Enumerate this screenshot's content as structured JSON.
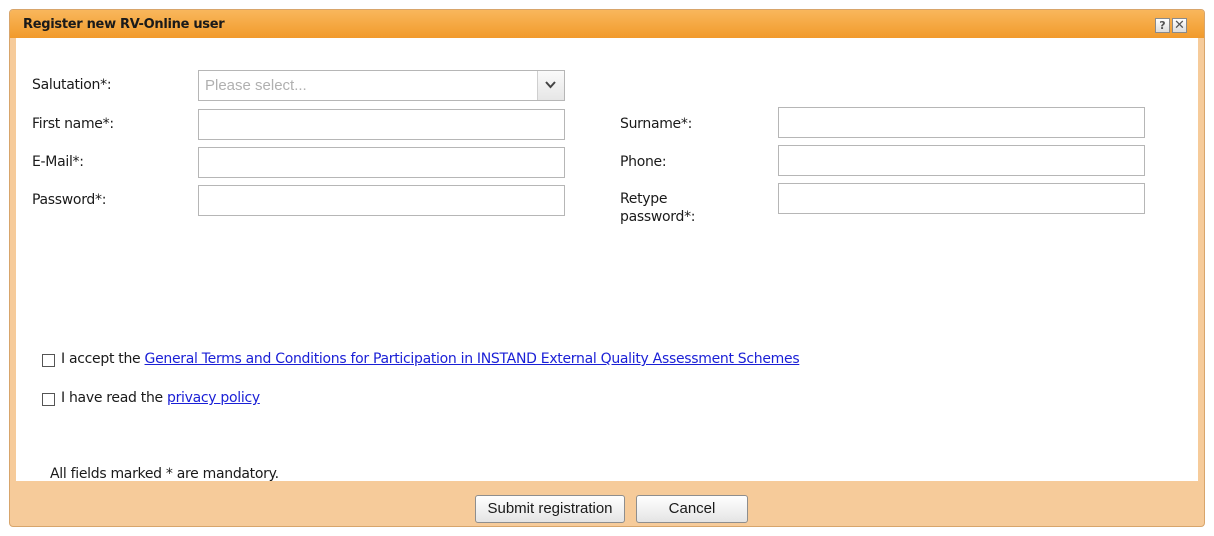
{
  "dialog": {
    "title": "Register new RV-Online user",
    "help_label": "?",
    "close_label": "✕"
  },
  "form": {
    "salutation": {
      "label": "Salutation*:",
      "placeholder": "Please select..."
    },
    "first_name": {
      "label": "First name*:",
      "value": ""
    },
    "surname": {
      "label": "Surname*:",
      "value": ""
    },
    "email": {
      "label": "E-Mail*:",
      "value": ""
    },
    "phone": {
      "label": "Phone:",
      "value": ""
    },
    "password": {
      "label": "Password*:",
      "value": ""
    },
    "retype_password": {
      "label_line1": "Retype",
      "label_line2": "password*:",
      "value": ""
    }
  },
  "terms": {
    "prefix": "I accept the ",
    "link": "General Terms and Conditions for Participation in INSTAND External Quality Assessment Schemes",
    "checked": false
  },
  "privacy": {
    "prefix": "I have read the ",
    "link": "privacy policy",
    "checked": false
  },
  "note": "All fields marked * are mandatory.",
  "buttons": {
    "submit": "Submit registration",
    "cancel": "Cancel"
  }
}
